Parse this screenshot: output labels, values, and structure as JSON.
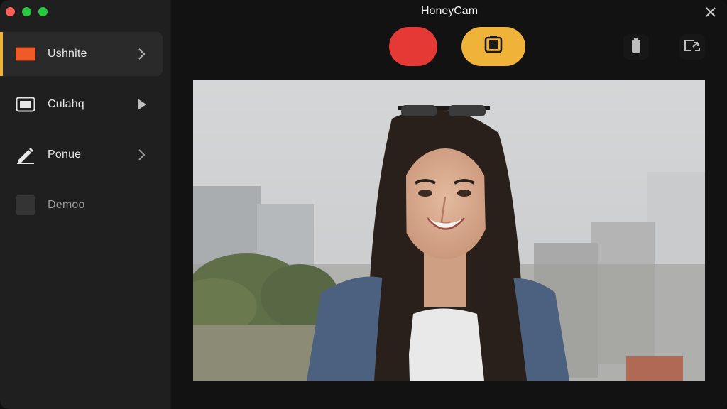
{
  "window": {
    "title": "HoneyCam"
  },
  "sidebar": {
    "items": [
      {
        "label": "Ushnite",
        "icon": "orange-rectangle-icon",
        "state": "active"
      },
      {
        "label": "Culahq",
        "icon": "display-icon",
        "state": "normal"
      },
      {
        "label": "Ponue",
        "icon": "pencil-icon",
        "state": "normal"
      },
      {
        "label": "Demoo",
        "icon": "square-icon",
        "state": "disabled"
      }
    ]
  },
  "toolbar": {
    "record_color": "#e53935",
    "snapshot_color": "#f0b33a",
    "accent": "#f0b33a"
  },
  "icons": {
    "close": "close-icon",
    "battery": "battery-icon",
    "switch_camera": "switch-camera-icon",
    "snapshot": "snapshot-icon"
  }
}
